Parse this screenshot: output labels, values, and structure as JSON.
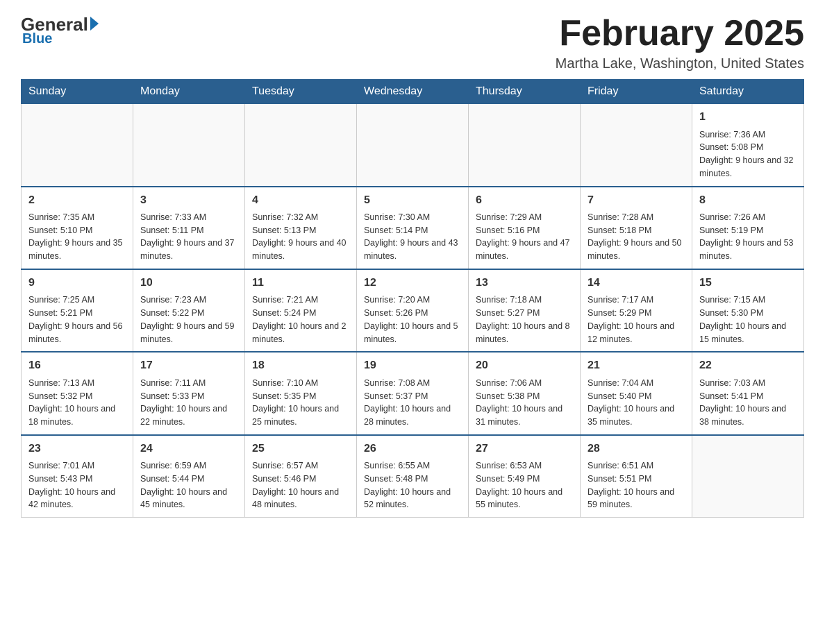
{
  "header": {
    "logo_general": "General",
    "logo_blue": "Blue",
    "month_title": "February 2025",
    "location": "Martha Lake, Washington, United States"
  },
  "weekdays": [
    "Sunday",
    "Monday",
    "Tuesday",
    "Wednesday",
    "Thursday",
    "Friday",
    "Saturday"
  ],
  "weeks": [
    [
      {
        "day": "",
        "info": ""
      },
      {
        "day": "",
        "info": ""
      },
      {
        "day": "",
        "info": ""
      },
      {
        "day": "",
        "info": ""
      },
      {
        "day": "",
        "info": ""
      },
      {
        "day": "",
        "info": ""
      },
      {
        "day": "1",
        "info": "Sunrise: 7:36 AM\nSunset: 5:08 PM\nDaylight: 9 hours and 32 minutes."
      }
    ],
    [
      {
        "day": "2",
        "info": "Sunrise: 7:35 AM\nSunset: 5:10 PM\nDaylight: 9 hours and 35 minutes."
      },
      {
        "day": "3",
        "info": "Sunrise: 7:33 AM\nSunset: 5:11 PM\nDaylight: 9 hours and 37 minutes."
      },
      {
        "day": "4",
        "info": "Sunrise: 7:32 AM\nSunset: 5:13 PM\nDaylight: 9 hours and 40 minutes."
      },
      {
        "day": "5",
        "info": "Sunrise: 7:30 AM\nSunset: 5:14 PM\nDaylight: 9 hours and 43 minutes."
      },
      {
        "day": "6",
        "info": "Sunrise: 7:29 AM\nSunset: 5:16 PM\nDaylight: 9 hours and 47 minutes."
      },
      {
        "day": "7",
        "info": "Sunrise: 7:28 AM\nSunset: 5:18 PM\nDaylight: 9 hours and 50 minutes."
      },
      {
        "day": "8",
        "info": "Sunrise: 7:26 AM\nSunset: 5:19 PM\nDaylight: 9 hours and 53 minutes."
      }
    ],
    [
      {
        "day": "9",
        "info": "Sunrise: 7:25 AM\nSunset: 5:21 PM\nDaylight: 9 hours and 56 minutes."
      },
      {
        "day": "10",
        "info": "Sunrise: 7:23 AM\nSunset: 5:22 PM\nDaylight: 9 hours and 59 minutes."
      },
      {
        "day": "11",
        "info": "Sunrise: 7:21 AM\nSunset: 5:24 PM\nDaylight: 10 hours and 2 minutes."
      },
      {
        "day": "12",
        "info": "Sunrise: 7:20 AM\nSunset: 5:26 PM\nDaylight: 10 hours and 5 minutes."
      },
      {
        "day": "13",
        "info": "Sunrise: 7:18 AM\nSunset: 5:27 PM\nDaylight: 10 hours and 8 minutes."
      },
      {
        "day": "14",
        "info": "Sunrise: 7:17 AM\nSunset: 5:29 PM\nDaylight: 10 hours and 12 minutes."
      },
      {
        "day": "15",
        "info": "Sunrise: 7:15 AM\nSunset: 5:30 PM\nDaylight: 10 hours and 15 minutes."
      }
    ],
    [
      {
        "day": "16",
        "info": "Sunrise: 7:13 AM\nSunset: 5:32 PM\nDaylight: 10 hours and 18 minutes."
      },
      {
        "day": "17",
        "info": "Sunrise: 7:11 AM\nSunset: 5:33 PM\nDaylight: 10 hours and 22 minutes."
      },
      {
        "day": "18",
        "info": "Sunrise: 7:10 AM\nSunset: 5:35 PM\nDaylight: 10 hours and 25 minutes."
      },
      {
        "day": "19",
        "info": "Sunrise: 7:08 AM\nSunset: 5:37 PM\nDaylight: 10 hours and 28 minutes."
      },
      {
        "day": "20",
        "info": "Sunrise: 7:06 AM\nSunset: 5:38 PM\nDaylight: 10 hours and 31 minutes."
      },
      {
        "day": "21",
        "info": "Sunrise: 7:04 AM\nSunset: 5:40 PM\nDaylight: 10 hours and 35 minutes."
      },
      {
        "day": "22",
        "info": "Sunrise: 7:03 AM\nSunset: 5:41 PM\nDaylight: 10 hours and 38 minutes."
      }
    ],
    [
      {
        "day": "23",
        "info": "Sunrise: 7:01 AM\nSunset: 5:43 PM\nDaylight: 10 hours and 42 minutes."
      },
      {
        "day": "24",
        "info": "Sunrise: 6:59 AM\nSunset: 5:44 PM\nDaylight: 10 hours and 45 minutes."
      },
      {
        "day": "25",
        "info": "Sunrise: 6:57 AM\nSunset: 5:46 PM\nDaylight: 10 hours and 48 minutes."
      },
      {
        "day": "26",
        "info": "Sunrise: 6:55 AM\nSunset: 5:48 PM\nDaylight: 10 hours and 52 minutes."
      },
      {
        "day": "27",
        "info": "Sunrise: 6:53 AM\nSunset: 5:49 PM\nDaylight: 10 hours and 55 minutes."
      },
      {
        "day": "28",
        "info": "Sunrise: 6:51 AM\nSunset: 5:51 PM\nDaylight: 10 hours and 59 minutes."
      },
      {
        "day": "",
        "info": ""
      }
    ]
  ]
}
